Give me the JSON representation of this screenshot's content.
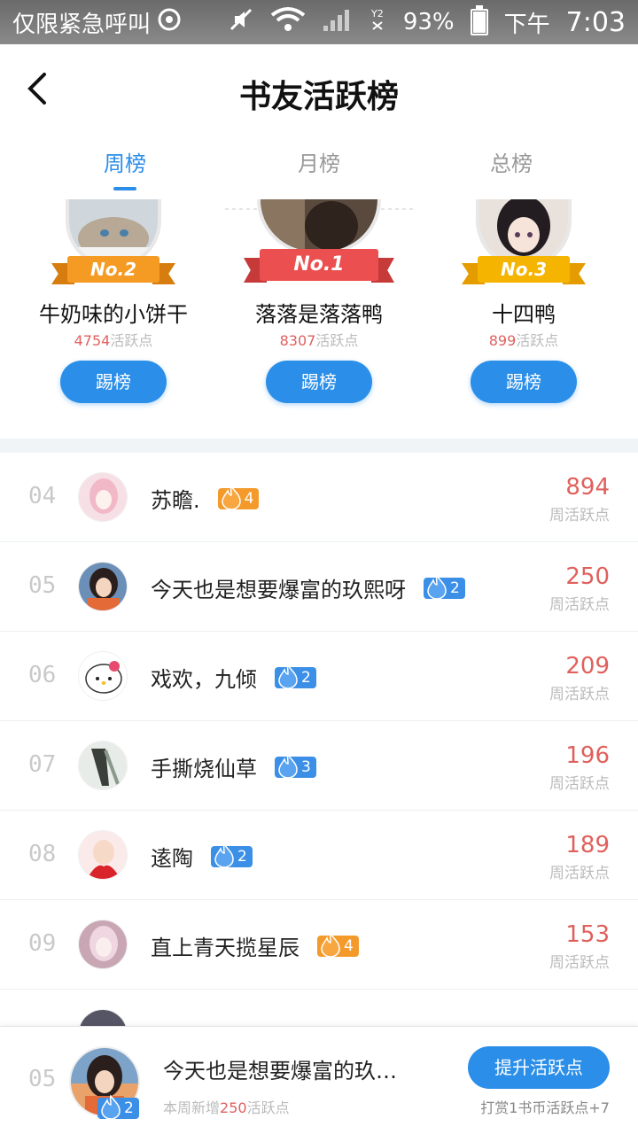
{
  "status_bar": {
    "carrier": "仅限紧急呼叫",
    "battery": "93%",
    "battery_level": 0.93,
    "time_prefix": "下午",
    "time": "7:03"
  },
  "header": {
    "title": "书友活跃榜",
    "back_icon": "chevron-left-icon"
  },
  "tabs": [
    {
      "label": "周榜",
      "active": true
    },
    {
      "label": "月榜",
      "active": false
    },
    {
      "label": "总榜",
      "active": false
    }
  ],
  "podium": [
    {
      "rank_label": "No.2",
      "name": "牛奶味的小饼干",
      "points": "4754",
      "points_unit": "活跃点",
      "button": "踢榜",
      "ribbon_color": "#f59a23"
    },
    {
      "rank_label": "No.1",
      "name": "落落是落落鸭",
      "points": "8307",
      "points_unit": "活跃点",
      "button": "踢榜",
      "ribbon_color": "#ec4f4f"
    },
    {
      "rank_label": "No.3",
      "name": "十四鸭",
      "points": "899",
      "points_unit": "活跃点",
      "button": "踢榜",
      "ribbon_color": "#f5b400"
    }
  ],
  "list": [
    {
      "rank": "04",
      "name": "苏瞻.",
      "badge": "4",
      "badge_color": "#f39a2b",
      "value": "894",
      "value_label": "周活跃点"
    },
    {
      "rank": "05",
      "name": "今天也是想要爆富的玖熙呀",
      "badge": "2",
      "badge_color": "#3b8fe6",
      "value": "250",
      "value_label": "周活跃点"
    },
    {
      "rank": "06",
      "name": "戏欢，九倾",
      "badge": "2",
      "badge_color": "#3b8fe6",
      "value": "209",
      "value_label": "周活跃点"
    },
    {
      "rank": "07",
      "name": "手撕烧仙草",
      "badge": "3",
      "badge_color": "#3b8fe6",
      "value": "196",
      "value_label": "周活跃点"
    },
    {
      "rank": "08",
      "name": "逺陶",
      "badge": "2",
      "badge_color": "#3b8fe6",
      "value": "189",
      "value_label": "周活跃点"
    },
    {
      "rank": "09",
      "name": "直上青天揽星辰",
      "badge": "4",
      "badge_color": "#f39a2b",
      "value": "153",
      "value_label": "周活跃点"
    }
  ],
  "my_rank": {
    "rank": "05",
    "name": "今天也是想要爆富的玖…",
    "badge": "2",
    "sub_prefix": "本周新增",
    "sub_value": "250",
    "sub_suffix": "活跃点",
    "button": "提升活跃点",
    "tip": "打赏1书币活跃点+7"
  }
}
